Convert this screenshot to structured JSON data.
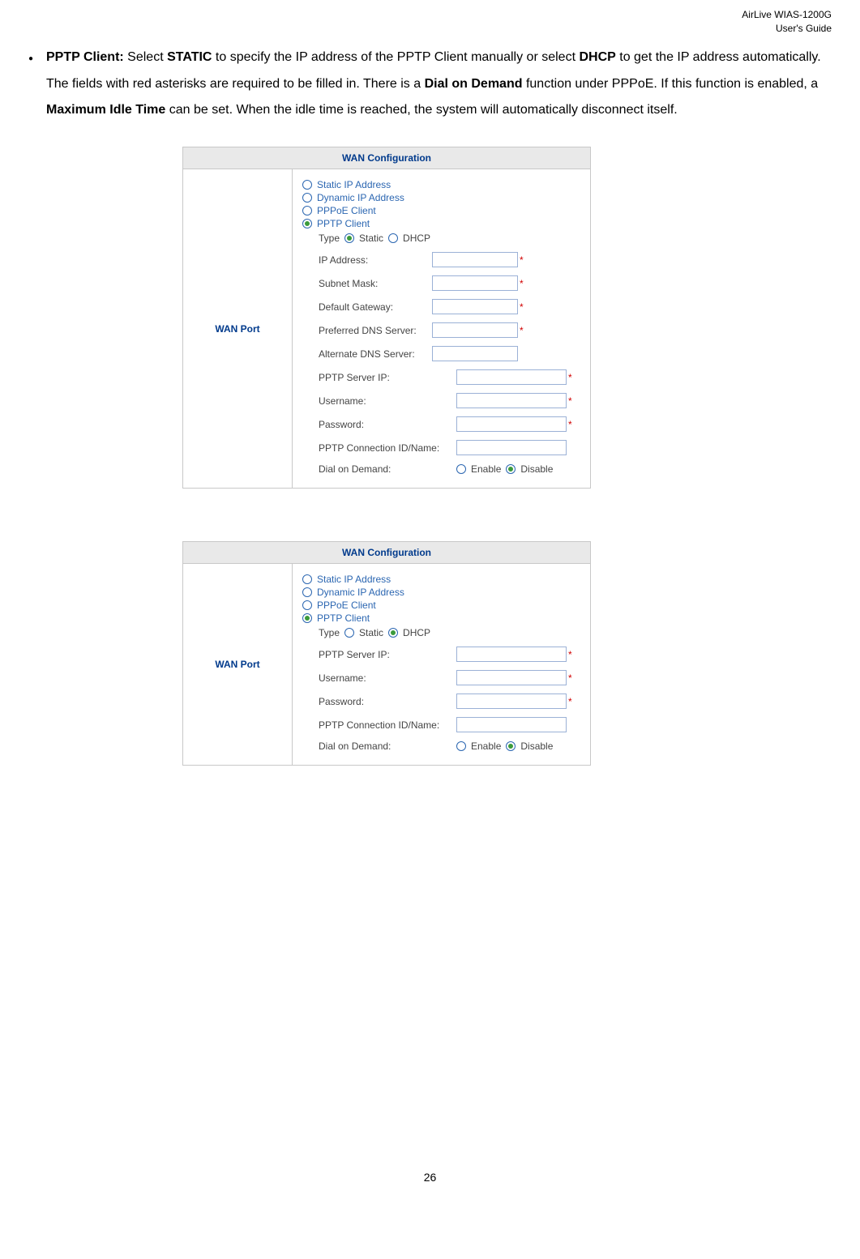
{
  "header": {
    "product": "AirLive WIAS-1200G",
    "docTitle": "User's Guide"
  },
  "bullet": {
    "lead": "PPTP Client:",
    "part1": " Select ",
    "static": "STATIC",
    "part2": " to specify the IP address of the PPTP Client manually or select ",
    "dhcp": "DHCP",
    "part3": " to get the IP address automatically. The fields with red asterisks are required to be filled in. There is a ",
    "dial": "Dial on Demand",
    "part4": " function under PPPoE. If this function is enabled, a ",
    "idle": "Maximum Idle Time",
    "part5": " can be set. When the idle time is reached, the system will automatically disconnect itself."
  },
  "panel": {
    "title": "WAN Configuration",
    "left": "WAN Port",
    "opts": {
      "staticIp": "Static IP Address",
      "dynamicIp": "Dynamic IP Address",
      "pppoe": "PPPoE Client",
      "pptp": "PPTP Client"
    },
    "typeLabel": "Type",
    "typeStatic": "Static",
    "typeDhcp": "DHCP",
    "fields": {
      "ip": "IP Address:",
      "subnet": "Subnet Mask:",
      "gateway": "Default Gateway:",
      "pdns": "Preferred DNS Server:",
      "adns": "Alternate DNS Server:",
      "pptpServer": "PPTP Server IP:",
      "username": "Username:",
      "password": "Password:",
      "connId": "PPTP Connection ID/Name:",
      "dial": "Dial on Demand:"
    },
    "dod": {
      "enable": "Enable",
      "disable": "Disable"
    }
  },
  "pageNumber": "26"
}
